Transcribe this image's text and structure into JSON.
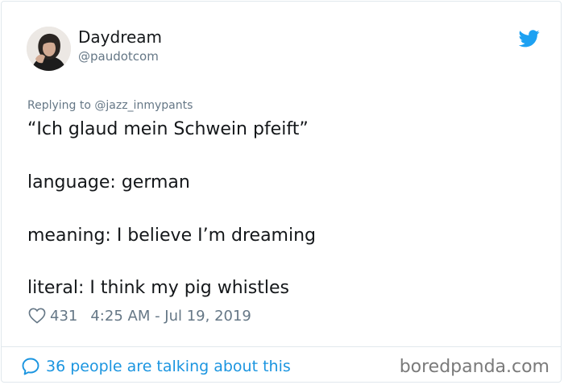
{
  "user": {
    "display_name": "Daydream",
    "handle": "@paudotcom"
  },
  "reply": {
    "prefix": "Replying to ",
    "to": "@jazz_inmypants"
  },
  "tweet": {
    "lines": [
      "“Ich glaud mein Schwein pfeift”",
      "language: german",
      "meaning: I believe I’m dreaming",
      "literal: I think my pig whistles"
    ]
  },
  "stats": {
    "likes": "431",
    "timestamp": "4:25 AM - Jul 19, 2019"
  },
  "footer": {
    "talking": "36 people are talking about this"
  },
  "watermark": "boredpanda.com",
  "colors": {
    "twitter_blue": "#1da1f2",
    "link_blue": "#1b95e0",
    "text_primary": "#14171a",
    "text_secondary": "#657786"
  },
  "icons": {
    "brand": "twitter-bird-icon",
    "like": "heart-outline-icon",
    "reply": "speech-bubble-icon"
  }
}
